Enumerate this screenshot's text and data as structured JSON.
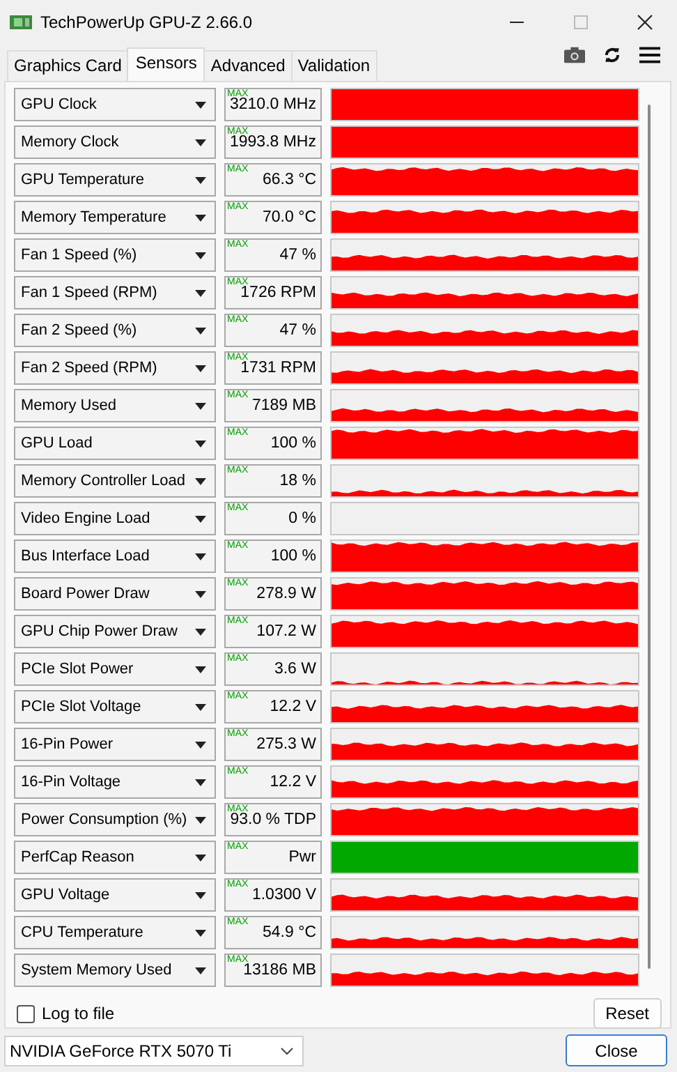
{
  "window": {
    "title": "TechPowerUp GPU-Z 2.66.0"
  },
  "tabs": [
    {
      "label": "Graphics Card",
      "selected": false
    },
    {
      "label": "Sensors",
      "selected": true
    },
    {
      "label": "Advanced",
      "selected": false
    },
    {
      "label": "Validation",
      "selected": false
    }
  ],
  "sensors": [
    {
      "name": "GPU Clock",
      "max_label": "MAX",
      "reading": "3210.0 MHz",
      "color": "#ff0000"
    },
    {
      "name": "Memory Clock",
      "max_label": "MAX",
      "reading": "1993.8 MHz",
      "color": "#ff0000"
    },
    {
      "name": "GPU Temperature",
      "max_label": "MAX",
      "reading": "66.3 °C",
      "color": "#ff0000"
    },
    {
      "name": "Memory Temperature",
      "max_label": "MAX",
      "reading": "70.0 °C",
      "color": "#ff0000"
    },
    {
      "name": "Fan 1 Speed (%)",
      "max_label": "MAX",
      "reading": "47 %",
      "color": "#ff0000"
    },
    {
      "name": "Fan 1 Speed (RPM)",
      "max_label": "MAX",
      "reading": "1726 RPM",
      "color": "#ff0000"
    },
    {
      "name": "Fan 2 Speed (%)",
      "max_label": "MAX",
      "reading": "47 %",
      "color": "#ff0000"
    },
    {
      "name": "Fan 2 Speed (RPM)",
      "max_label": "MAX",
      "reading": "1731 RPM",
      "color": "#ff0000"
    },
    {
      "name": "Memory Used",
      "max_label": "MAX",
      "reading": "7189 MB",
      "color": "#ff0000"
    },
    {
      "name": "GPU Load",
      "max_label": "MAX",
      "reading": "100 %",
      "color": "#ff0000"
    },
    {
      "name": "Memory Controller Load",
      "max_label": "MAX",
      "reading": "18 %",
      "color": "#ff0000"
    },
    {
      "name": "Video Engine Load",
      "max_label": "MAX",
      "reading": "0 %"
    },
    {
      "name": "Bus Interface Load",
      "max_label": "MAX",
      "reading": "100 %",
      "color": "#ff0000"
    },
    {
      "name": "Board Power Draw",
      "max_label": "MAX",
      "reading": "278.9 W",
      "color": "#ff0000"
    },
    {
      "name": "GPU Chip Power Draw",
      "max_label": "MAX",
      "reading": "107.2 W",
      "color": "#ff0000"
    },
    {
      "name": "PCIe Slot Power",
      "max_label": "MAX",
      "reading": "3.6 W",
      "color": "#ff0000"
    },
    {
      "name": "PCIe Slot Voltage",
      "max_label": "MAX",
      "reading": "12.2 V",
      "color": "#ff0000"
    },
    {
      "name": "16-Pin Power",
      "max_label": "MAX",
      "reading": "275.3 W",
      "color": "#ff0000"
    },
    {
      "name": "16-Pin Voltage",
      "max_label": "MAX",
      "reading": "12.2 V",
      "color": "#ff0000"
    },
    {
      "name": "Power Consumption (%)",
      "max_label": "MAX",
      "reading": "93.0 % TDP",
      "color": "#ff0000"
    },
    {
      "name": "PerfCap Reason",
      "max_label": "MAX",
      "reading": "Pwr",
      "color": "#00a800"
    },
    {
      "name": "GPU Voltage",
      "max_label": "MAX",
      "reading": "1.0300 V",
      "color": "#ff0000"
    },
    {
      "name": "CPU Temperature",
      "max_label": "MAX",
      "reading": "54.9 °C",
      "color": "#ff0000"
    },
    {
      "name": "System Memory Used",
      "max_label": "MAX",
      "reading": "13186 MB",
      "color": "#ff0000"
    }
  ],
  "log_to_file": {
    "label": "Log to file",
    "checked": false
  },
  "reset_button": "Reset",
  "gpu_select": {
    "value": "NVIDIA GeForce RTX 5070 Ti"
  },
  "close_button": "Close"
}
